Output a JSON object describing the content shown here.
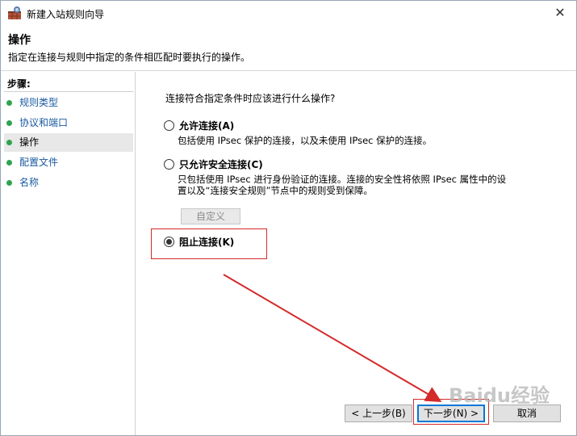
{
  "window": {
    "title": "新建入站规则向导",
    "close_glyph": "✕"
  },
  "header": {
    "title": "操作",
    "description": "指定在连接与规则中指定的条件相匹配时要执行的操作。"
  },
  "sidebar": {
    "heading": "步骤:",
    "items": [
      {
        "label": "规则类型"
      },
      {
        "label": "协议和端口"
      },
      {
        "label": "操作"
      },
      {
        "label": "配置文件"
      },
      {
        "label": "名称"
      }
    ]
  },
  "main": {
    "question": "连接符合指定条件时应该进行什么操作?",
    "options": [
      {
        "label": "允许连接(A)",
        "description": [
          "包括使用 IPsec 保护的连接，以及未使用 IPsec 保护的连接。"
        ],
        "selected": false
      },
      {
        "label": "只允许安全连接(C)",
        "description": [
          "只包括使用 IPsec 进行身份验证的连接。连接的安全性将依照 IPsec 属性中的设",
          "置以及“连接安全规则”节点中的规则受到保障。"
        ],
        "selected": false
      },
      {
        "label": "阻止连接(K)",
        "description": [],
        "selected": true
      }
    ],
    "customize_label": "自定义"
  },
  "footer": {
    "back_label": "< 上一步(B)",
    "next_label": "下一步(N) >",
    "cancel_label": "取消"
  },
  "watermark": "Baidu经验",
  "colors": {
    "annotation_red": "#d42a2a",
    "step_dot": "#2ea44f",
    "link_blue": "#1a5aa0",
    "default_button": "#0078d7"
  }
}
